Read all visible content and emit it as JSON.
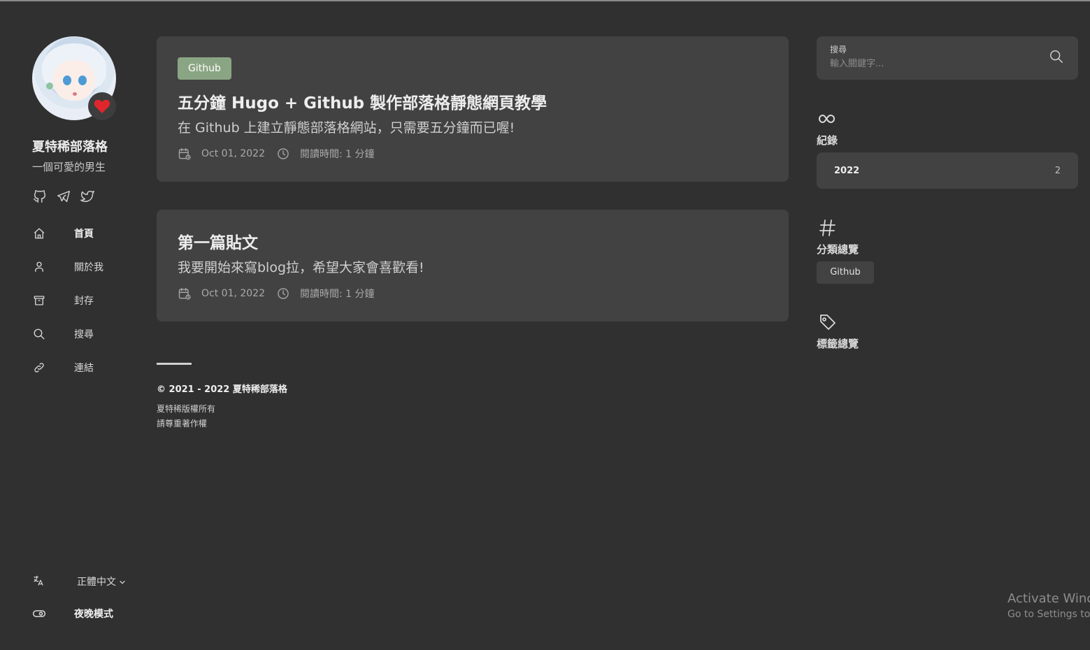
{
  "sidebar": {
    "site_title": "夏特稀部落格",
    "site_subtitle": "一個可愛的男生",
    "socials": [
      "github-icon",
      "telegram-icon",
      "twitter-icon"
    ],
    "nav": [
      {
        "label": "首頁",
        "icon": "home-icon"
      },
      {
        "label": "關於我",
        "icon": "user-icon"
      },
      {
        "label": "封存",
        "icon": "archive-icon"
      },
      {
        "label": "搜尋",
        "icon": "search-icon"
      },
      {
        "label": "連結",
        "icon": "link-icon"
      }
    ],
    "language": "正體中文",
    "dark_mode_label": "夜晚模式"
  },
  "posts": [
    {
      "category": "Github",
      "title": "五分鐘 Hugo + Github 製作部落格靜態網頁教學",
      "description": "在 Github 上建立靜態部落格網站，只需要五分鐘而已喔!",
      "date": "Oct 01, 2022",
      "read_time": "閱讀時間: 1 分鐘"
    },
    {
      "title": "第一篇貼文",
      "description": "我要開始來寫blog拉，希望大家會喜歡看!",
      "date": "Oct 01, 2022",
      "read_time": "閱讀時間: 1 分鐘"
    }
  ],
  "footer": {
    "copyright": "© 2021 - 2022 夏特稀部落格",
    "line1": "夏特稀版權所有",
    "line2": "請尊重著作權"
  },
  "search": {
    "label": "搜尋",
    "placeholder": "輸入關鍵字..."
  },
  "archives": {
    "title": "紀錄",
    "items": [
      {
        "year": "2022",
        "count": "2"
      }
    ]
  },
  "categories": {
    "title": "分類總覽",
    "items": [
      "Github"
    ]
  },
  "tags": {
    "title": "標籤總覽"
  },
  "watermark": {
    "line1": "Activate Winc",
    "line2": "Go to Settings to"
  },
  "colors": {
    "background": "#303030",
    "card": "#424242",
    "accent": "#8aa583",
    "heart": "#e0262d"
  }
}
